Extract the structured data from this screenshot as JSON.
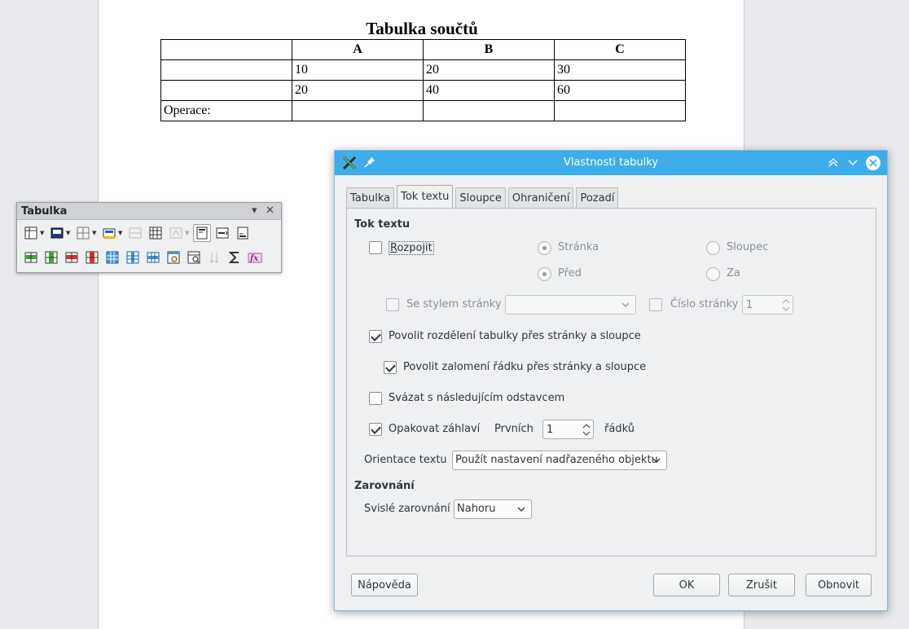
{
  "document": {
    "title": "Tabulka součtů",
    "table": {
      "header": [
        "",
        "A",
        "B",
        "C"
      ],
      "rows": [
        [
          "",
          "10",
          "20",
          "30"
        ],
        [
          "",
          "20",
          "40",
          "60"
        ],
        [
          "Operace:",
          "",
          "",
          ""
        ]
      ]
    }
  },
  "toolbar": {
    "title": "Tabulka",
    "icons_row1": [
      "table-insert-icon",
      "borders-icon",
      "cell-background-icon",
      "table-autoformat-icon",
      "merge-cells-icon",
      "split-cells-icon",
      "table-properties-icon",
      "optimize-icon",
      "align-top-icon",
      "align-center-icon",
      "align-bottom-icon"
    ],
    "icons_row2": [
      "insert-rows-above-icon",
      "insert-columns-icon",
      "delete-rows-icon",
      "delete-columns-icon",
      "select-table-icon",
      "select-column-icon",
      "select-row-icon",
      "table-properties-dialog-icon",
      "table-number-format-icon",
      "sort-icon",
      "sum-icon",
      "formula-icon"
    ]
  },
  "dialog": {
    "title": "Vlastnosti tabulky",
    "tabs": [
      "Tabulka",
      "Tok textu",
      "Sloupce",
      "Ohraničení",
      "Pozadí"
    ],
    "active_tab": "Tok textu",
    "text_flow": {
      "section_title": "Tok textu",
      "break_label": "Rozpojit",
      "page_label": "Stránka",
      "column_label": "Sloupec",
      "before_label": "Před",
      "after_label": "Za",
      "page_style_label": "Se stylem stránky",
      "page_style_value": "",
      "page_number_label": "Číslo stránky",
      "page_number_value": "1",
      "allow_split_table_label": "Povolit rozdělení tabulky přes stránky a sloupce",
      "allow_split_row_label": "Povolit zalomení řádku přes stránky a sloupce",
      "keep_with_next_label": "Svázat s následujícím odstavcem",
      "repeat_heading_label": "Opakovat záhlaví",
      "first_label": "Prvních",
      "first_value": "1",
      "rows_label": "řádků",
      "orientation_label": "Orientace textu",
      "orientation_value": "Použít nastavení nadřazeného objektu"
    },
    "alignment": {
      "section_title": "Zarovnání",
      "vertical_label": "Svislé zarovnání",
      "vertical_value": "Nahoru"
    },
    "buttons": {
      "help": "Nápověda",
      "ok": "OK",
      "cancel": "Zrušit",
      "reset": "Obnovit"
    },
    "state": {
      "break_checked": false,
      "page_style_checked": false,
      "page_number_checked": false,
      "allow_split_table_checked": true,
      "allow_split_row_checked": true,
      "keep_with_next_checked": false,
      "repeat_heading_checked": true
    }
  },
  "colors": {
    "titlebar": "#3daee9",
    "window_bg": "#eff0f1",
    "text": "#31363b"
  }
}
